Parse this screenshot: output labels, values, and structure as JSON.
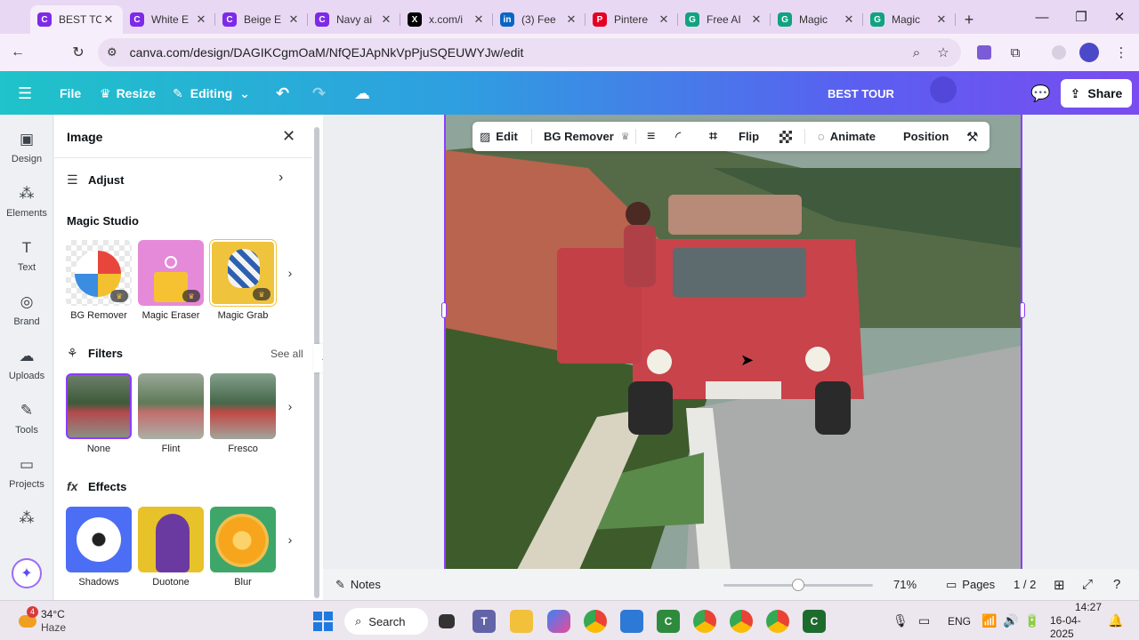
{
  "browser": {
    "tabs": [
      {
        "label": "BEST TO",
        "icon": "canva-icon",
        "color": "#7d2ae8",
        "glyph": "C",
        "active": true
      },
      {
        "label": "White E",
        "icon": "canva-icon",
        "color": "#7d2ae8",
        "glyph": "C",
        "active": false
      },
      {
        "label": "Beige E",
        "icon": "canva-icon",
        "color": "#7d2ae8",
        "glyph": "C",
        "active": false
      },
      {
        "label": "Navy ai",
        "icon": "canva-icon",
        "color": "#7d2ae8",
        "glyph": "C",
        "active": false
      },
      {
        "label": "x.com/i",
        "icon": "x-icon",
        "color": "#000000",
        "glyph": "X",
        "active": false
      },
      {
        "label": "(3) Fee",
        "icon": "linkedin-icon",
        "color": "#0a66c2",
        "glyph": "in",
        "active": false
      },
      {
        "label": "Pintere",
        "icon": "pinterest-icon",
        "color": "#e60023",
        "glyph": "P",
        "active": false
      },
      {
        "label": "Free AI",
        "icon": "chatgpt-icon",
        "color": "#10a37f",
        "glyph": "G",
        "active": false
      },
      {
        "label": "Magic",
        "icon": "chatgpt-icon",
        "color": "#10a37f",
        "glyph": "G",
        "active": false
      },
      {
        "label": "Magic",
        "icon": "chatgpt-icon",
        "color": "#10a37f",
        "glyph": "G",
        "active": false
      }
    ],
    "url": "canva.com/design/DAGIKCgmOaM/NfQEJApNkVpPjuSQEUWYJw/edit"
  },
  "header": {
    "file": "File",
    "resize": "Resize",
    "editing": "Editing",
    "design_title": "BEST TOUR",
    "share": "Share"
  },
  "rail": [
    {
      "label": "Design",
      "icon": "design-icon",
      "glyph": "▣"
    },
    {
      "label": "Elements",
      "icon": "elements-icon",
      "glyph": "⁂"
    },
    {
      "label": "Text",
      "icon": "text-icon",
      "glyph": "T"
    },
    {
      "label": "Brand",
      "icon": "brand-icon",
      "glyph": "◎"
    },
    {
      "label": "Uploads",
      "icon": "uploads-icon",
      "glyph": "☁"
    },
    {
      "label": "Tools",
      "icon": "tools-icon",
      "glyph": "✎"
    },
    {
      "label": "Projects",
      "icon": "projects-icon",
      "glyph": "▭"
    }
  ],
  "panel": {
    "title": "Image",
    "adjust": "Adjust",
    "magic_studio": "Magic Studio",
    "magic_tools": [
      "BG Remover",
      "Magic Eraser",
      "Magic Grab"
    ],
    "filters_label": "Filters",
    "see_all": "See all",
    "filters": [
      "None",
      "Flint",
      "Fresco"
    ],
    "effects_label": "Effects",
    "effects": [
      "Shadows",
      "Duotone",
      "Blur"
    ]
  },
  "toolbar": {
    "edit": "Edit",
    "bg_remover": "BG Remover",
    "flip": "Flip",
    "animate": "Animate",
    "position": "Position"
  },
  "status": {
    "notes": "Notes",
    "zoom": "71%",
    "zoom_fraction": 0.5,
    "pages": "Pages",
    "page_count": "1 / 2"
  },
  "taskbar": {
    "weather_temp": "34°C",
    "weather_text": "Haze",
    "weather_badge": "4",
    "search": "Search",
    "language": "ENG",
    "time": "14:27",
    "date": "16-04-2025"
  }
}
